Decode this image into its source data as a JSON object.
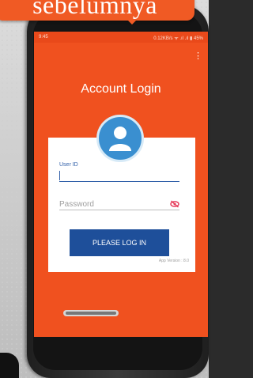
{
  "banner": {
    "text": "sebelumnya"
  },
  "statusbar": {
    "time": "9:45",
    "right": "0.12KB/s ᯤ .ıl .ıl ▮ 45%"
  },
  "appbar": {
    "menu_icon": "more-vert-icon",
    "menu_glyph": "⋮"
  },
  "login": {
    "title": "Account Login",
    "userid_label": "User ID",
    "userid_value": "",
    "password_placeholder": "Password",
    "password_value": "",
    "button_label": "PLEASE LOG IN",
    "version": "App Version : 8.0"
  },
  "colors": {
    "screen_bg": "#f0511f",
    "button_bg": "#1e4f9a",
    "avatar_bg": "#3a8fd0",
    "banner_bg": "#f05a24"
  }
}
